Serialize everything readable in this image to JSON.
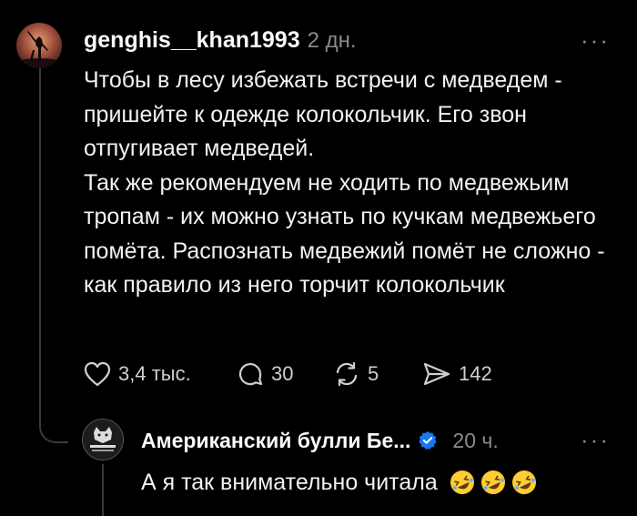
{
  "post": {
    "username": "genghis__khan1993",
    "time": "2 дн.",
    "paragraphs": [
      "Чтобы в лесу избежать встречи с медведем - пришейте к одежде колокольчик. Его звон отпугивает медведей.",
      "Так же рекомендуем не ходить по медвежьим тропам - их можно узнать по кучкам медвежьего помёта. Распознать медвежий помёт не сложно - как правило из него торчит колокольчик"
    ],
    "likes": "3,4 тыс.",
    "comments": "30",
    "reposts": "5",
    "shares": "142"
  },
  "reply": {
    "username": "Американский булли Бе...",
    "time": "20 ч.",
    "text": "А я так внимательно читала",
    "avatar_caption": "AMERICAN BULLY"
  },
  "more_label": "···",
  "colors": {
    "background": "#000000",
    "text": "#f2f2f2",
    "muted": "#8a8a8a",
    "verified": "#1877f2",
    "thread_line": "#3a3a3a",
    "emoji": "#ffcc33"
  },
  "icons": {
    "like": "heart-icon",
    "comment": "comment-icon",
    "repost": "repost-icon",
    "share": "share-icon",
    "verified": "verified-badge-icon",
    "emoji": "rofl-emoji"
  }
}
